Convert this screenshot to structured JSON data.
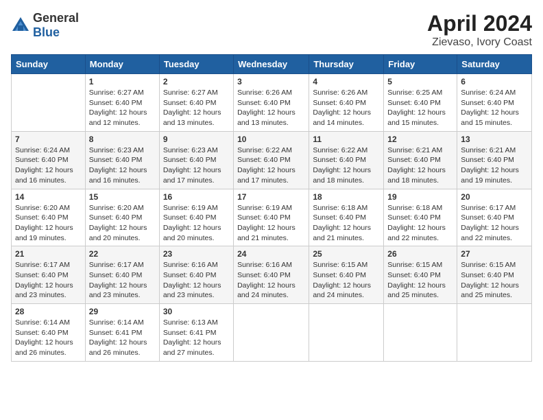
{
  "header": {
    "logo_general": "General",
    "logo_blue": "Blue",
    "title": "April 2024",
    "subtitle": "Zievaso, Ivory Coast"
  },
  "days_of_week": [
    "Sunday",
    "Monday",
    "Tuesday",
    "Wednesday",
    "Thursday",
    "Friday",
    "Saturday"
  ],
  "weeks": [
    [
      {
        "day": "",
        "info": ""
      },
      {
        "day": "1",
        "info": "Sunrise: 6:27 AM\nSunset: 6:40 PM\nDaylight: 12 hours\nand 12 minutes."
      },
      {
        "day": "2",
        "info": "Sunrise: 6:27 AM\nSunset: 6:40 PM\nDaylight: 12 hours\nand 13 minutes."
      },
      {
        "day": "3",
        "info": "Sunrise: 6:26 AM\nSunset: 6:40 PM\nDaylight: 12 hours\nand 13 minutes."
      },
      {
        "day": "4",
        "info": "Sunrise: 6:26 AM\nSunset: 6:40 PM\nDaylight: 12 hours\nand 14 minutes."
      },
      {
        "day": "5",
        "info": "Sunrise: 6:25 AM\nSunset: 6:40 PM\nDaylight: 12 hours\nand 15 minutes."
      },
      {
        "day": "6",
        "info": "Sunrise: 6:24 AM\nSunset: 6:40 PM\nDaylight: 12 hours\nand 15 minutes."
      }
    ],
    [
      {
        "day": "7",
        "info": "Sunrise: 6:24 AM\nSunset: 6:40 PM\nDaylight: 12 hours\nand 16 minutes."
      },
      {
        "day": "8",
        "info": "Sunrise: 6:23 AM\nSunset: 6:40 PM\nDaylight: 12 hours\nand 16 minutes."
      },
      {
        "day": "9",
        "info": "Sunrise: 6:23 AM\nSunset: 6:40 PM\nDaylight: 12 hours\nand 17 minutes."
      },
      {
        "day": "10",
        "info": "Sunrise: 6:22 AM\nSunset: 6:40 PM\nDaylight: 12 hours\nand 17 minutes."
      },
      {
        "day": "11",
        "info": "Sunrise: 6:22 AM\nSunset: 6:40 PM\nDaylight: 12 hours\nand 18 minutes."
      },
      {
        "day": "12",
        "info": "Sunrise: 6:21 AM\nSunset: 6:40 PM\nDaylight: 12 hours\nand 18 minutes."
      },
      {
        "day": "13",
        "info": "Sunrise: 6:21 AM\nSunset: 6:40 PM\nDaylight: 12 hours\nand 19 minutes."
      }
    ],
    [
      {
        "day": "14",
        "info": "Sunrise: 6:20 AM\nSunset: 6:40 PM\nDaylight: 12 hours\nand 19 minutes."
      },
      {
        "day": "15",
        "info": "Sunrise: 6:20 AM\nSunset: 6:40 PM\nDaylight: 12 hours\nand 20 minutes."
      },
      {
        "day": "16",
        "info": "Sunrise: 6:19 AM\nSunset: 6:40 PM\nDaylight: 12 hours\nand 20 minutes."
      },
      {
        "day": "17",
        "info": "Sunrise: 6:19 AM\nSunset: 6:40 PM\nDaylight: 12 hours\nand 21 minutes."
      },
      {
        "day": "18",
        "info": "Sunrise: 6:18 AM\nSunset: 6:40 PM\nDaylight: 12 hours\nand 21 minutes."
      },
      {
        "day": "19",
        "info": "Sunrise: 6:18 AM\nSunset: 6:40 PM\nDaylight: 12 hours\nand 22 minutes."
      },
      {
        "day": "20",
        "info": "Sunrise: 6:17 AM\nSunset: 6:40 PM\nDaylight: 12 hours\nand 22 minutes."
      }
    ],
    [
      {
        "day": "21",
        "info": "Sunrise: 6:17 AM\nSunset: 6:40 PM\nDaylight: 12 hours\nand 23 minutes."
      },
      {
        "day": "22",
        "info": "Sunrise: 6:17 AM\nSunset: 6:40 PM\nDaylight: 12 hours\nand 23 minutes."
      },
      {
        "day": "23",
        "info": "Sunrise: 6:16 AM\nSunset: 6:40 PM\nDaylight: 12 hours\nand 23 minutes."
      },
      {
        "day": "24",
        "info": "Sunrise: 6:16 AM\nSunset: 6:40 PM\nDaylight: 12 hours\nand 24 minutes."
      },
      {
        "day": "25",
        "info": "Sunrise: 6:15 AM\nSunset: 6:40 PM\nDaylight: 12 hours\nand 24 minutes."
      },
      {
        "day": "26",
        "info": "Sunrise: 6:15 AM\nSunset: 6:40 PM\nDaylight: 12 hours\nand 25 minutes."
      },
      {
        "day": "27",
        "info": "Sunrise: 6:15 AM\nSunset: 6:40 PM\nDaylight: 12 hours\nand 25 minutes."
      }
    ],
    [
      {
        "day": "28",
        "info": "Sunrise: 6:14 AM\nSunset: 6:40 PM\nDaylight: 12 hours\nand 26 minutes."
      },
      {
        "day": "29",
        "info": "Sunrise: 6:14 AM\nSunset: 6:41 PM\nDaylight: 12 hours\nand 26 minutes."
      },
      {
        "day": "30",
        "info": "Sunrise: 6:13 AM\nSunset: 6:41 PM\nDaylight: 12 hours\nand 27 minutes."
      },
      {
        "day": "",
        "info": ""
      },
      {
        "day": "",
        "info": ""
      },
      {
        "day": "",
        "info": ""
      },
      {
        "day": "",
        "info": ""
      }
    ]
  ]
}
